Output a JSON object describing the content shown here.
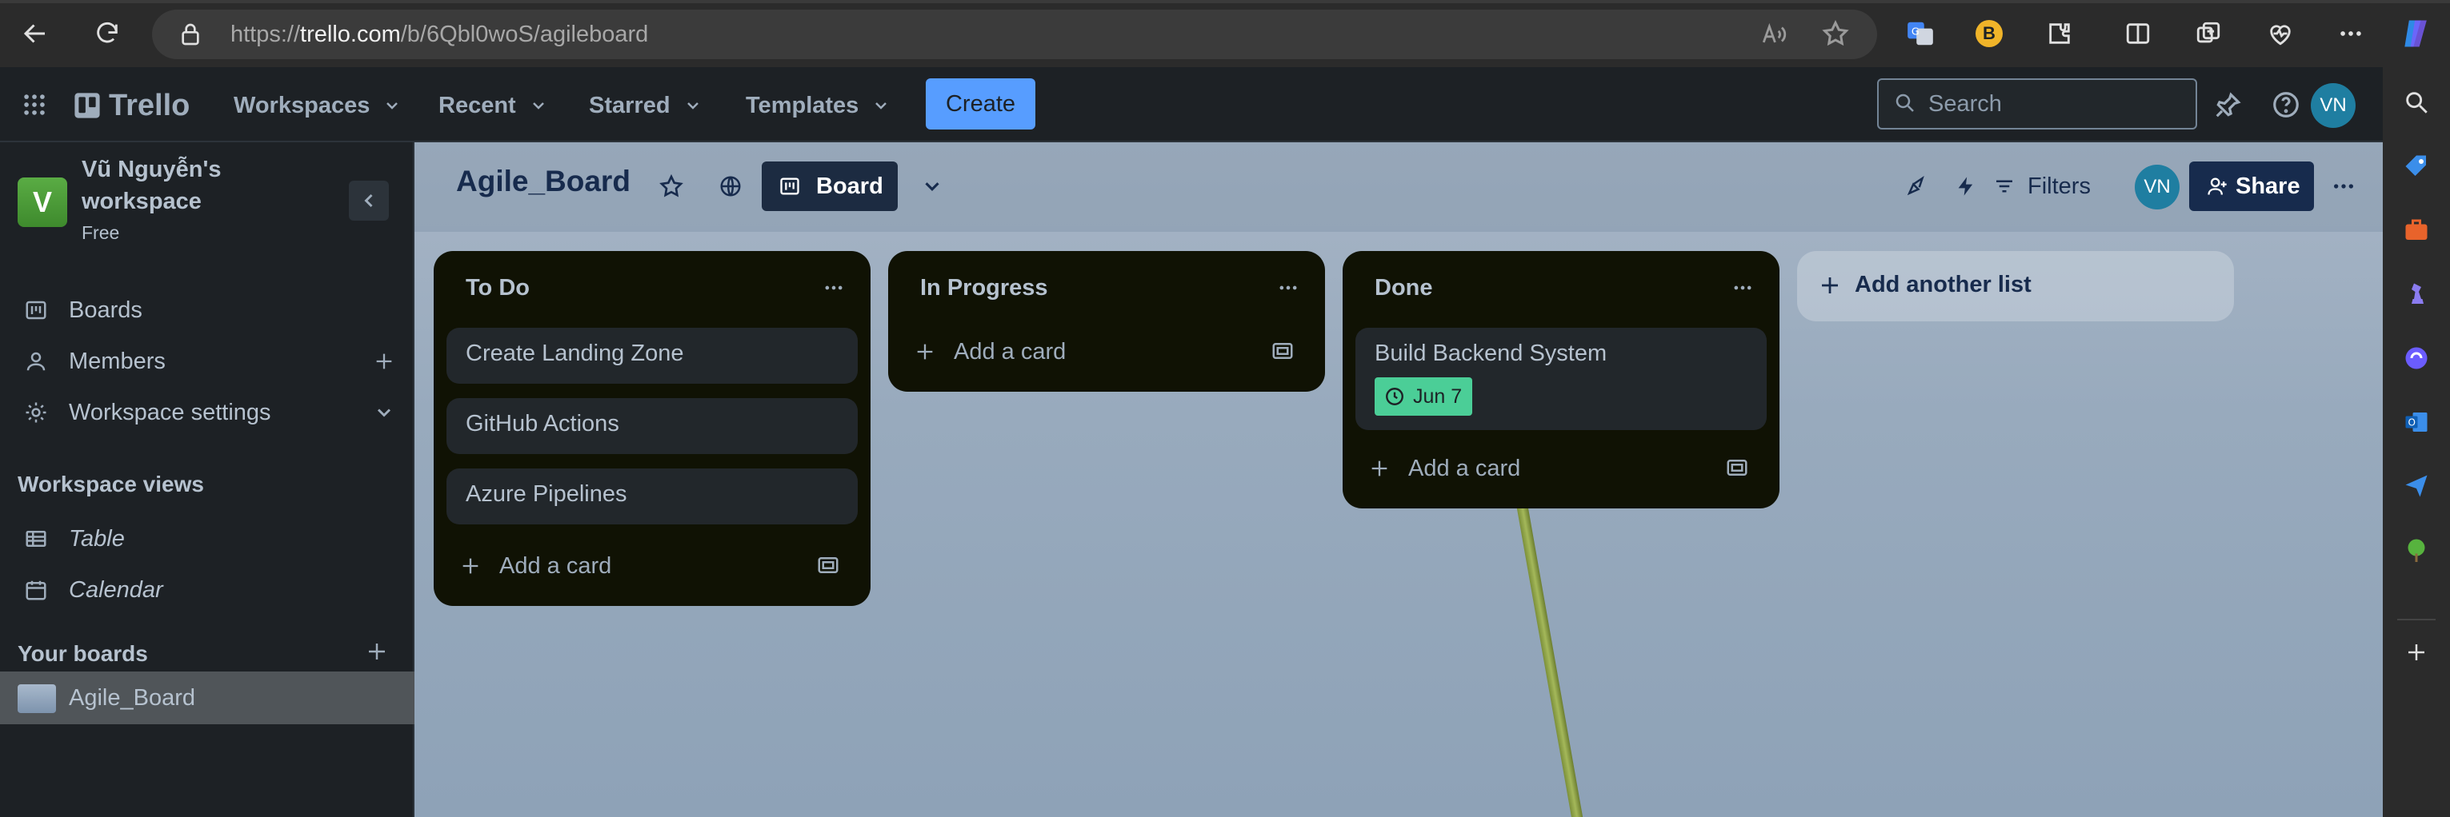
{
  "browser": {
    "url_prefix": "https://",
    "url_host": "trello.com",
    "url_path": "/b/6Qbl0woS/agileboard",
    "extension_badge": "B"
  },
  "header": {
    "app_name": "Trello",
    "menus": [
      "Workspaces",
      "Recent",
      "Starred",
      "Templates"
    ],
    "create_label": "Create",
    "search_placeholder": "Search",
    "user_initials": "VN"
  },
  "sidebar": {
    "workspace_initial": "V",
    "workspace_name": "Vũ Nguyễn's workspace",
    "workspace_plan": "Free",
    "items": [
      {
        "label": "Boards"
      },
      {
        "label": "Members"
      },
      {
        "label": "Workspace settings"
      }
    ],
    "views_heading": "Workspace views",
    "views": [
      {
        "label": "Table"
      },
      {
        "label": "Calendar"
      }
    ],
    "boards_heading": "Your boards",
    "boards": [
      {
        "label": "Agile_Board"
      }
    ]
  },
  "board": {
    "title": "Agile_Board",
    "view_label": "Board",
    "filters_label": "Filters",
    "member_initials": "VN",
    "share_label": "Share",
    "lists": [
      {
        "title": "To Do",
        "cards": [
          {
            "title": "Create Landing Zone"
          },
          {
            "title": "GitHub Actions"
          },
          {
            "title": "Azure Pipelines"
          }
        ],
        "add_card_label": "Add a card"
      },
      {
        "title": "In Progress",
        "cards": [],
        "add_card_label": "Add a card"
      },
      {
        "title": "Done",
        "cards": [
          {
            "title": "Build Backend System",
            "due": "Jun 7"
          }
        ],
        "add_card_label": "Add a card"
      }
    ],
    "add_list_label": "Add another list"
  },
  "colors": {
    "accent": "#579dff",
    "list_bg": "#101204",
    "card_bg": "#22272b",
    "due_complete": "#4bce97",
    "workspace_avatar": "#5aac44"
  }
}
